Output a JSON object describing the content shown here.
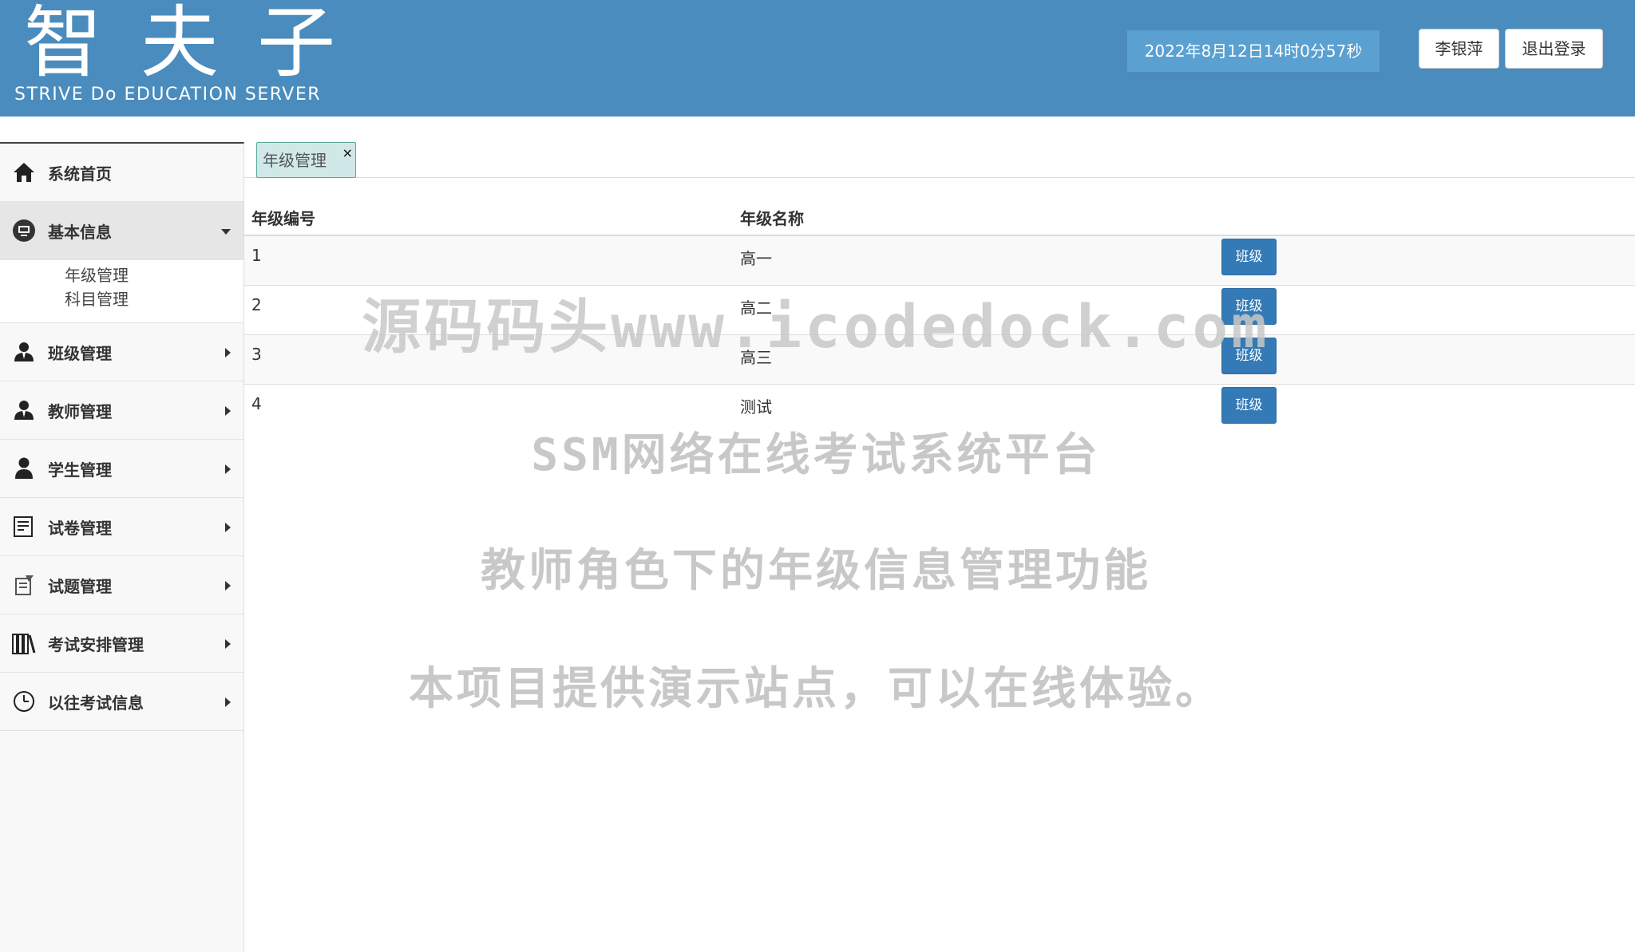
{
  "header": {
    "logo_cn": "智夫子",
    "logo_en": "STRIVE Do EDUCATION SERVER",
    "datetime": "2022年8月12日14时0分57秒",
    "user_label": "李银萍",
    "logout_label": "退出登录",
    "background_color": "#4a8cbd"
  },
  "sidebar": {
    "items": [
      {
        "label": "系统首页",
        "icon": "home-icon"
      },
      {
        "label": "基本信息",
        "icon": "monitor-icon",
        "expanded": true,
        "children": [
          {
            "label": "年级管理"
          },
          {
            "label": "科目管理"
          }
        ]
      },
      {
        "label": "班级管理",
        "icon": "user-icon"
      },
      {
        "label": "教师管理",
        "icon": "user-icon"
      },
      {
        "label": "学生管理",
        "icon": "user-icon"
      },
      {
        "label": "试卷管理",
        "icon": "document-icon"
      },
      {
        "label": "试题管理",
        "icon": "edit-icon"
      },
      {
        "label": "考试安排管理",
        "icon": "books-icon"
      },
      {
        "label": "以往考试信息",
        "icon": "clock-icon"
      }
    ]
  },
  "tabs": [
    {
      "label": "年级管理",
      "close": "×"
    }
  ],
  "table": {
    "headers": [
      "年级编号",
      "年级名称"
    ],
    "action_label": "班级",
    "rows": [
      {
        "id": "1",
        "name": "高一"
      },
      {
        "id": "2",
        "name": "高二"
      },
      {
        "id": "3",
        "name": "高三"
      },
      {
        "id": "4",
        "name": "测试"
      }
    ]
  },
  "watermark": {
    "line1": "源码码头www.icodedock.com",
    "line2": "SSM网络在线考试系统平台",
    "line3": "教师角色下的年级信息管理功能",
    "line4": "本项目提供演示站点，可以在线体验。"
  }
}
